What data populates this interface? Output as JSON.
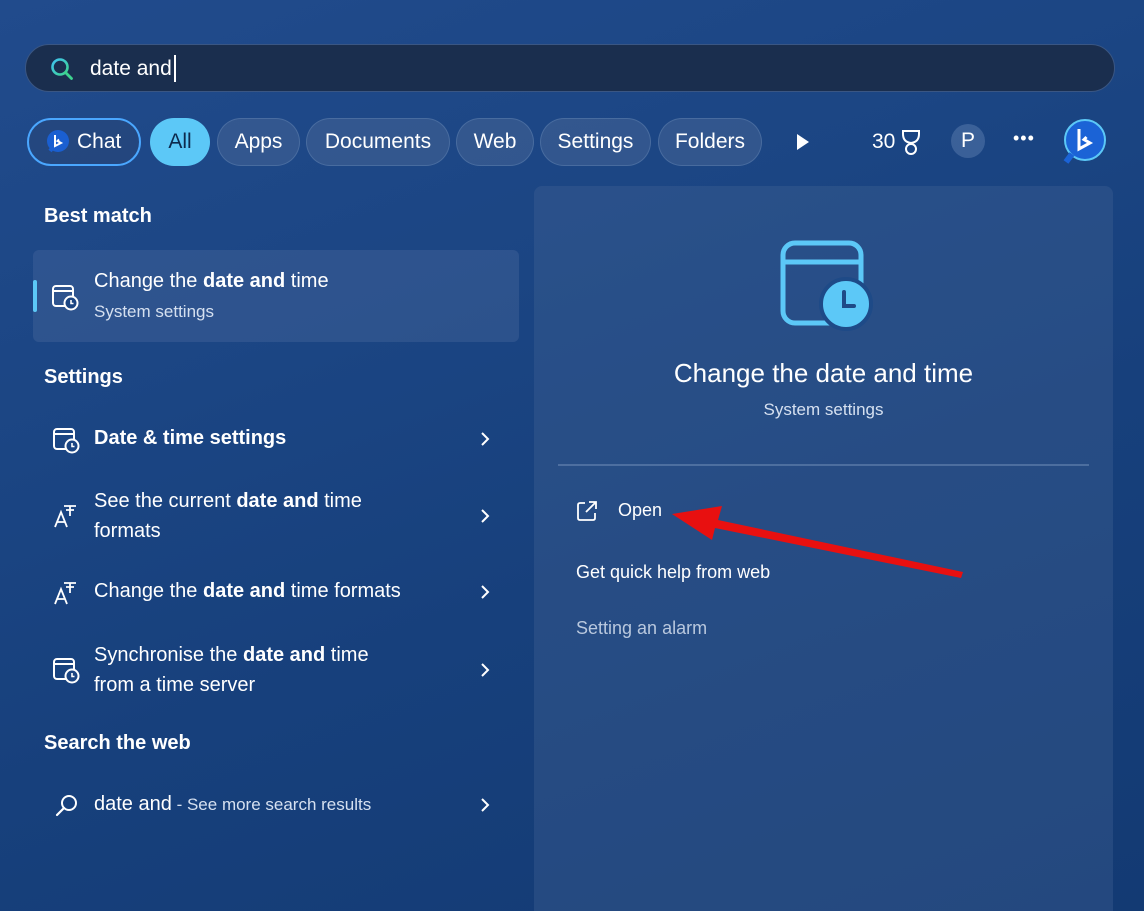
{
  "search": {
    "value": "date and",
    "placeholder": ""
  },
  "filters": {
    "chat": "Chat",
    "all": "All",
    "apps": "Apps",
    "documents": "Documents",
    "web": "Web",
    "settings": "Settings",
    "folders": "Folders"
  },
  "topbar": {
    "points": "30",
    "profile_initial": "P",
    "more": "•••"
  },
  "best_match": {
    "heading": "Best match",
    "title_pre": "Change the ",
    "title_bold": "date and",
    "title_post": " time",
    "subtitle": "System settings"
  },
  "settings_section": {
    "heading": "Settings",
    "items": [
      {
        "bold": "Date & time settings",
        "icon": "calendar-clock-icon"
      },
      {
        "pre": "See the current ",
        "bold": "date and",
        "post": " time",
        "line2": "formats",
        "icon": "text-format-icon"
      },
      {
        "pre": "Change the ",
        "bold": "date and",
        "post": " time formats",
        "icon": "text-format-icon"
      },
      {
        "pre": "Synchronise the ",
        "bold": "date and",
        "post": " time",
        "line2": "from a time server",
        "icon": "calendar-clock-icon"
      }
    ]
  },
  "web_section": {
    "heading": "Search the web",
    "query": "date and",
    "suffix": " - See more search results"
  },
  "detail": {
    "title": "Change the date and time",
    "subtitle": "System settings",
    "actions": {
      "open": "Open",
      "quick_help": "Get quick help from web",
      "alarm": "Setting an alarm"
    }
  },
  "colors": {
    "accent": "#5cc8f7",
    "annotation_arrow": "#e81010"
  }
}
